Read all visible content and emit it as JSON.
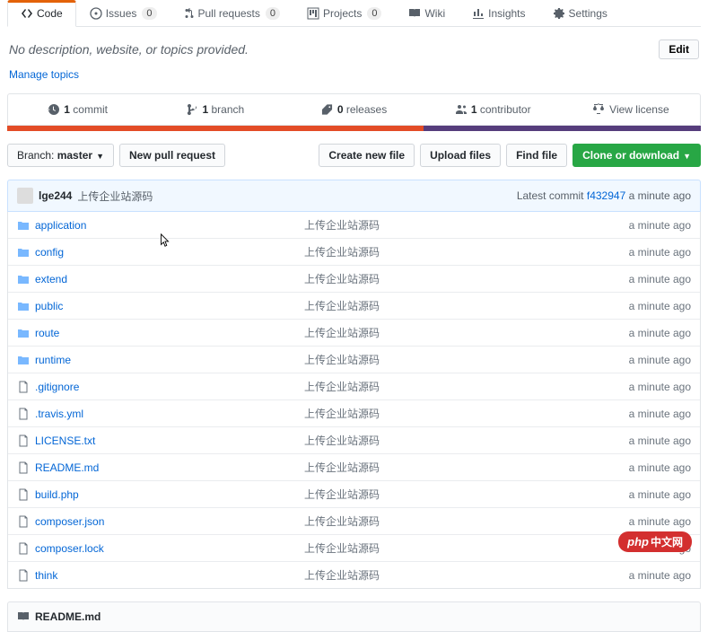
{
  "tabs": [
    {
      "label": "Code",
      "count": null,
      "active": true,
      "icon": "code"
    },
    {
      "label": "Issues",
      "count": "0",
      "icon": "issue"
    },
    {
      "label": "Pull requests",
      "count": "0",
      "icon": "pr"
    },
    {
      "label": "Projects",
      "count": "0",
      "icon": "project"
    },
    {
      "label": "Wiki",
      "count": null,
      "icon": "wiki"
    },
    {
      "label": "Insights",
      "count": null,
      "icon": "insights"
    },
    {
      "label": "Settings",
      "count": null,
      "icon": "gear"
    }
  ],
  "description": "No description, website, or topics provided.",
  "edit_label": "Edit",
  "manage_label": "Manage topics",
  "stats": {
    "commits": {
      "n": "1",
      "label": "commit"
    },
    "branches": {
      "n": "1",
      "label": "branch"
    },
    "releases": {
      "n": "0",
      "label": "releases"
    },
    "contributors": {
      "n": "1",
      "label": "contributor"
    },
    "license": {
      "label": "View license"
    }
  },
  "branch_selector": {
    "prefix": "Branch:",
    "name": "master"
  },
  "new_pr_label": "New pull request",
  "file_actions": {
    "create": "Create new file",
    "upload": "Upload files",
    "find": "Find file",
    "clone": "Clone or download"
  },
  "latest_commit": {
    "author": "lge244",
    "message": "上传企业站源码",
    "prefix": "Latest commit",
    "sha": "f432947",
    "time": "a minute ago"
  },
  "files": [
    {
      "type": "dir",
      "name": "application",
      "msg": "上传企业站源码",
      "time": "a minute ago"
    },
    {
      "type": "dir",
      "name": "config",
      "msg": "上传企业站源码",
      "time": "a minute ago"
    },
    {
      "type": "dir",
      "name": "extend",
      "msg": "上传企业站源码",
      "time": "a minute ago"
    },
    {
      "type": "dir",
      "name": "public",
      "msg": "上传企业站源码",
      "time": "a minute ago"
    },
    {
      "type": "dir",
      "name": "route",
      "msg": "上传企业站源码",
      "time": "a minute ago"
    },
    {
      "type": "dir",
      "name": "runtime",
      "msg": "上传企业站源码",
      "time": "a minute ago"
    },
    {
      "type": "file",
      "name": ".gitignore",
      "msg": "上传企业站源码",
      "time": "a minute ago"
    },
    {
      "type": "file",
      "name": ".travis.yml",
      "msg": "上传企业站源码",
      "time": "a minute ago"
    },
    {
      "type": "file",
      "name": "LICENSE.txt",
      "msg": "上传企业站源码",
      "time": "a minute ago"
    },
    {
      "type": "file",
      "name": "README.md",
      "msg": "上传企业站源码",
      "time": "a minute ago"
    },
    {
      "type": "file",
      "name": "build.php",
      "msg": "上传企业站源码",
      "time": "a minute ago"
    },
    {
      "type": "file",
      "name": "composer.json",
      "msg": "上传企业站源码",
      "time": "a minute ago"
    },
    {
      "type": "file",
      "name": "composer.lock",
      "msg": "上传企业站源码",
      "time": "a minute ago"
    },
    {
      "type": "file",
      "name": "think",
      "msg": "上传企业站源码",
      "time": "a minute ago"
    }
  ],
  "readme_title": "README.md",
  "badge": {
    "brand": "php",
    "cn": "中文网"
  }
}
